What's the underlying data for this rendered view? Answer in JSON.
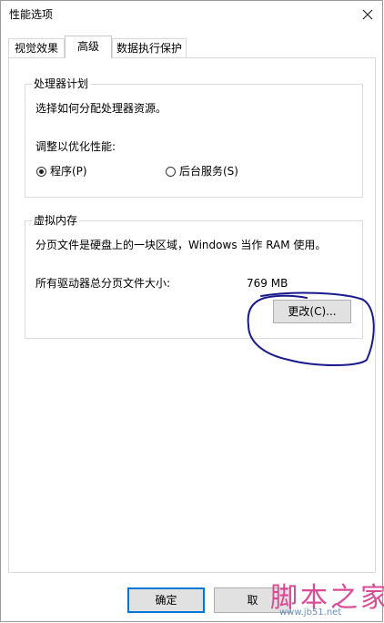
{
  "window": {
    "title": "性能选项"
  },
  "tabs": [
    {
      "label": "视觉效果"
    },
    {
      "label": "高级",
      "selected": true
    },
    {
      "label": "数据执行保护"
    }
  ],
  "processor_group": {
    "title": "处理器计划",
    "description": "选择如何分配处理器资源。",
    "adjust_label": "调整以优化性能:",
    "options": [
      {
        "label": "程序(P)",
        "checked": true
      },
      {
        "label": "后台服务(S)",
        "checked": false
      }
    ]
  },
  "virtual_memory_group": {
    "title": "虚拟内存",
    "description": "分页文件是硬盘上的一块区域，Windows 当作 RAM 使用。",
    "total_label": "所有驱动器总分页文件大小:",
    "total_value": "769 MB",
    "change_button": "更改(C)..."
  },
  "buttons": {
    "ok": "确定",
    "cancel": "取"
  },
  "watermark": {
    "text": "脚本之家",
    "url": "www.jb51.net"
  },
  "colors": {
    "annotation": "#1a1a8c",
    "focus_border": "#0078d7",
    "watermark": "#d63a8b"
  }
}
